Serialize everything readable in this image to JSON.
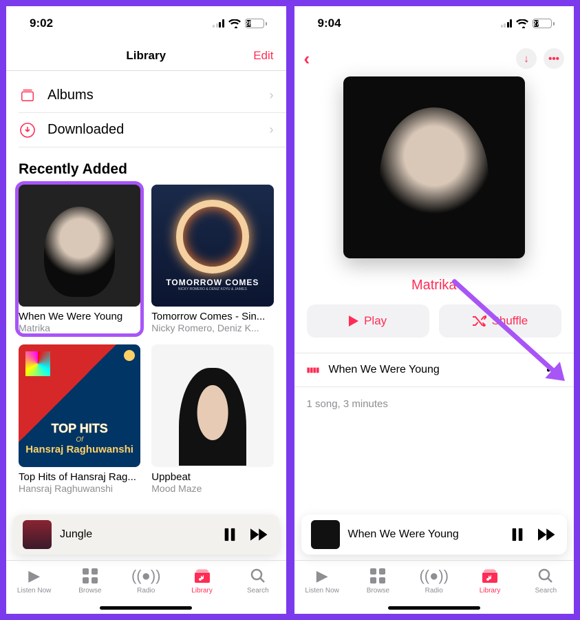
{
  "screen1": {
    "status": {
      "time": "9:02",
      "battery_pct": "28",
      "battery_fill_pct": 28
    },
    "header": {
      "title": "Library",
      "edit": "Edit"
    },
    "rows": {
      "albums": "Albums",
      "downloaded": "Downloaded"
    },
    "section": "Recently Added",
    "albums": [
      {
        "title": "When We Were Young",
        "artist": "Matrika"
      },
      {
        "title": "Tomorrow Comes - Sin...",
        "artist": "Nicky Romero, Deniz K...",
        "art_text": "TOMORROW COMES",
        "art_sub": "NICKY ROMERO & DENIZ KOYU & JAIMES"
      },
      {
        "title": "Top Hits of Hansraj Rag...",
        "artist": "Hansraj Raghuwanshi",
        "art_l1": "TOP HITS",
        "art_l2": "Of",
        "art_l3": "Hansraj Raghuwanshi"
      },
      {
        "title": "Uppbeat",
        "artist": "Mood Maze"
      }
    ],
    "mini": {
      "title": "Jungle"
    },
    "tabs": [
      "Listen Now",
      "Browse",
      "Radio",
      "Library",
      "Search"
    ]
  },
  "screen2": {
    "status": {
      "time": "9:04",
      "battery_pct": "27",
      "battery_fill_pct": 27
    },
    "artist": "Matrika",
    "play": "Play",
    "shuffle": "Shuffle",
    "track": "When We Were Young",
    "summary": "1 song, 3 minutes",
    "mini": {
      "title": "When We Were Young"
    },
    "tabs": [
      "Listen Now",
      "Browse",
      "Radio",
      "Library",
      "Search"
    ]
  }
}
